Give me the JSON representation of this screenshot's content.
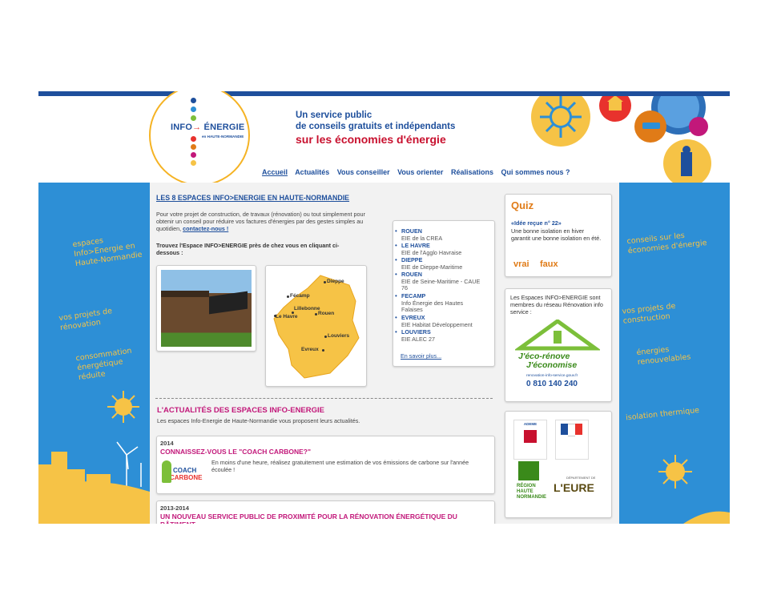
{
  "header": {
    "logo_text": "INFO",
    "logo_arrow": "→",
    "logo_word": "ÉNERGIE",
    "logo_sub": "en HAUTE-NORMANDIE",
    "tagline_line1": "Un service public",
    "tagline_line2": "de conseils gratuits et indépendants",
    "tagline_line3": "sur les économies d'énergie"
  },
  "nav": {
    "items": [
      "Accueil",
      "Actualités",
      "Vous conseiller",
      "Vous orienter",
      "Réalisations",
      "Qui sommes nous ?"
    ]
  },
  "left_sidebar": {
    "phrases": [
      "espaces Info>Energie en Haute-Normandie",
      "vos projets de rénovation",
      "consommation énergétique réduite"
    ]
  },
  "right_sidebar": {
    "phrases": [
      "conseils sur les économies d'énergie",
      "vos projets de construction",
      "énergies renouvelables",
      "isolation thermique"
    ]
  },
  "espaces": {
    "title": "LES 8 ESPACES INFO>ENERGIE EN HAUTE-NORMANDIE",
    "intro": "Pour votre projet de construction, de travaux (rénovation) ou tout simplement pour obtenir un conseil pour réduire vos factures d'énergies par des gestes simples au quotidien,",
    "contact_link": "contactez-nous !",
    "find_text": "Trouvez l'Espace INFO>ENERGIE près de chez vous en cliquant ci-dessous :",
    "map_cities": [
      "Dieppe",
      "Fécamp",
      "Lillebonne",
      "Le Havre",
      "Rouen",
      "Louviers",
      "Evreux"
    ],
    "list": [
      {
        "city": "ROUEN",
        "desc": "EIE de la CREA"
      },
      {
        "city": "LE HAVRE",
        "desc": "EIE de l'Agglo Havraise"
      },
      {
        "city": "DIEPPE",
        "desc": "EIE de Dieppe-Maritime"
      },
      {
        "city": "ROUEN",
        "desc": "EIE de Seine-Maritime - CAUE 76"
      },
      {
        "city": "FECAMP",
        "desc": "Info Énergie des Hautes Falaises"
      },
      {
        "city": "EVREUX",
        "desc": "EIE Habitat Développement"
      },
      {
        "city": "LOUVIERS",
        "desc": "EIE ALEC 27"
      }
    ],
    "more_link": "En savoir plus..."
  },
  "actualites": {
    "title": "L'ACTUALITÉS DES ESPACES INFO-ENERGIE",
    "subtitle": "Les espaces Info-Energie de Haute-Normandie vous proposent leurs actualités.",
    "news": [
      {
        "year": "2014",
        "title": "CONNAISSEZ-VOUS LE \"COACH CARBONE?\"",
        "text": "En moins d'une heure, réalisez gratuitement une estimation de vos émissions de carbone sur l'année écoulée !",
        "thumb_line1": "COACH",
        "thumb_line2": "CARBONE"
      },
      {
        "year": "2013-2014",
        "title": "UN NOUVEAU SERVICE PUBLIC DE PROXIMITÉ POUR LA RÉNOVATION ÉNERGÉTIQUE DU BÂTIMENT"
      }
    ]
  },
  "quiz": {
    "title": "Quiz",
    "subtitle": "«Idée reçue n° 22»",
    "question": "Une bonne isolation en hiver garantit une bonne isolation en été.",
    "true_label": "vrai",
    "false_label": "faux"
  },
  "reseau": {
    "text": "Les Espaces INFO>ENERGIE sont membres du réseau Rénovation info service :",
    "logo_line1": "J'éco-rénove",
    "logo_line2": "J'économise",
    "url": "renovation-info-service.gouv.fr",
    "phone": "0 810 140 240"
  },
  "partners": {
    "ademe": "ADEME",
    "region_line1": "RÉGION",
    "region_line2": "HAUTE",
    "region_line3": "NORMANDIE",
    "dept_small": "DÉPARTEMENT DE",
    "dept_name": "L'EURE"
  },
  "colors": {
    "brand_blue": "#1e4f9c",
    "brand_red": "#c8102e",
    "accent_magenta": "#c2187a",
    "accent_orange": "#e07b17",
    "sidebar_blue": "#2d8fd6",
    "sun_yellow": "#f6c346"
  }
}
